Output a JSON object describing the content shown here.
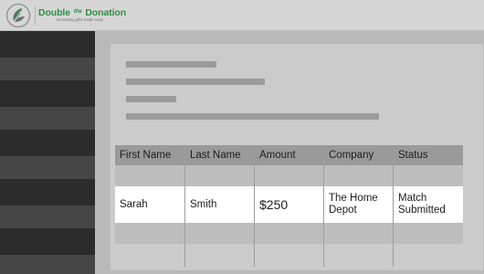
{
  "header": {
    "brand_name_part1": "Double",
    "brand_name_the": "the",
    "brand_name_part2": "Donation",
    "tagline": "increasing gifts made easy",
    "logo_icon": "leaf-logo-icon",
    "brand_color": "#2f8f44"
  },
  "table": {
    "columns": [
      "First Name",
      "Last Name",
      "Amount",
      "Company",
      "Status"
    ],
    "rows": [
      {
        "first_name": "Sarah",
        "last_name": "Smith",
        "amount": "$250",
        "company": "The Home Depot",
        "status": "Match Submitted"
      }
    ]
  }
}
